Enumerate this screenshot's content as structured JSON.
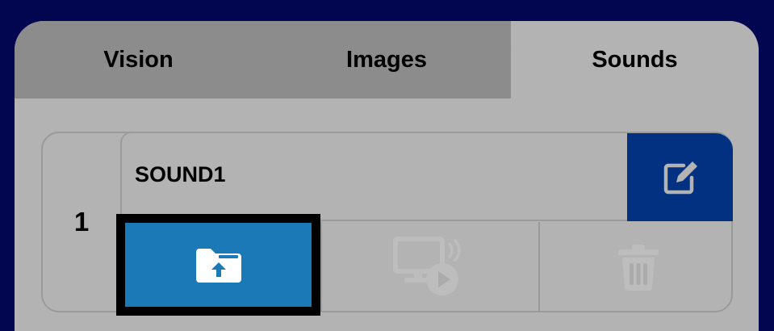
{
  "tabs": [
    {
      "label": "Vision",
      "active": false
    },
    {
      "label": "Images",
      "active": false
    },
    {
      "label": "Sounds",
      "active": true
    }
  ],
  "sound_card": {
    "index": "1",
    "name": "SOUND1",
    "edit_icon": "edit-icon",
    "upload_icon": "folder-upload-icon",
    "play_icon": "screen-play-icon",
    "delete_icon": "trash-icon"
  },
  "colors": {
    "background": "#020550",
    "panel": "#b3b3b3",
    "inactive_tab": "#8c8c8c",
    "edit_button": "#013180",
    "upload_button": "#1c79b8"
  }
}
